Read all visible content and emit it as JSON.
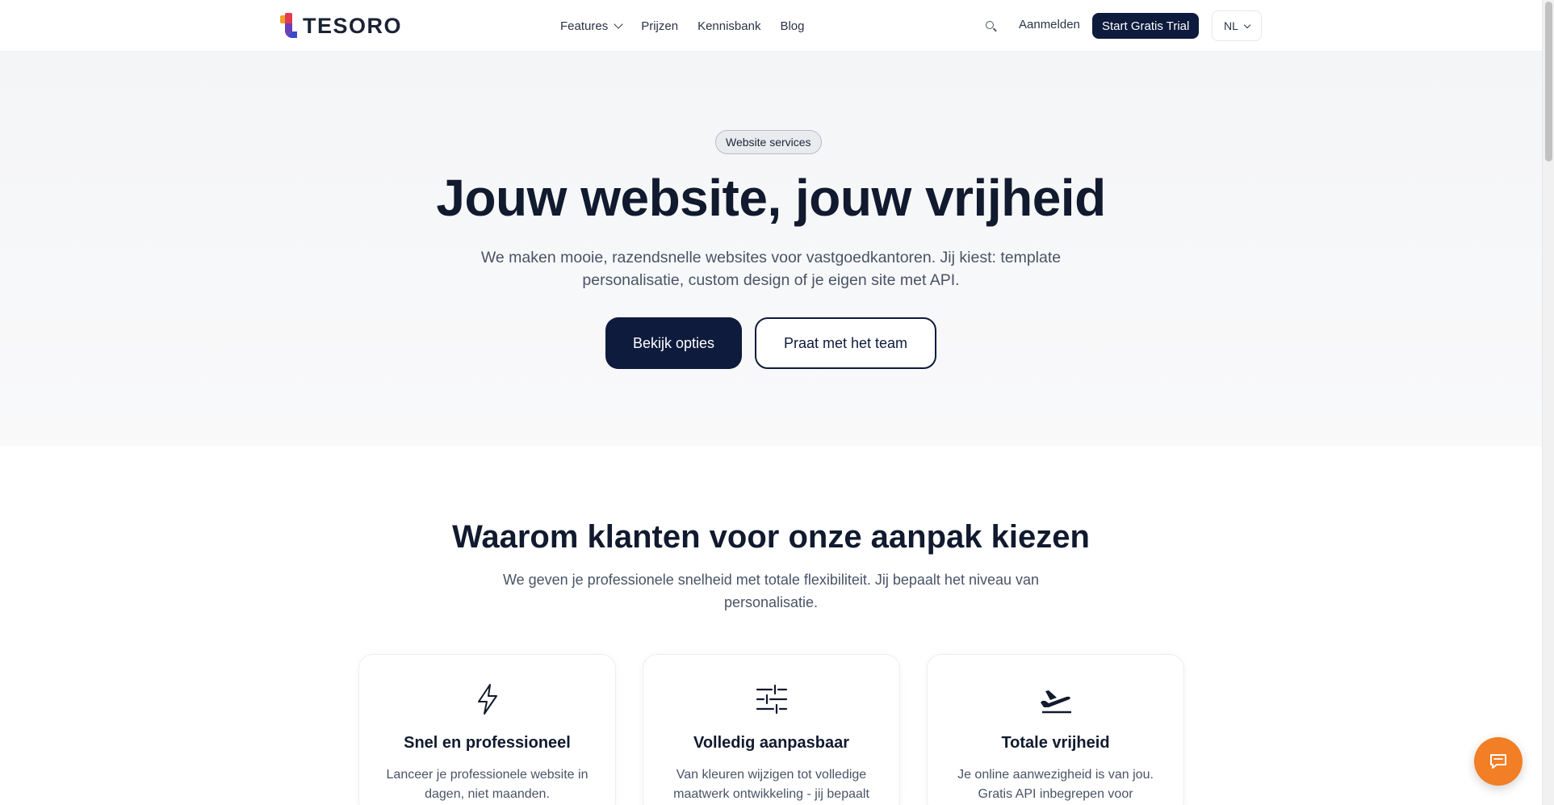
{
  "header": {
    "logo_text": "TESORO",
    "nav": [
      {
        "label": "Features"
      },
      {
        "label": "Prijzen"
      },
      {
        "label": "Kennisbank"
      },
      {
        "label": "Blog"
      }
    ],
    "login_label": "Aanmelden",
    "trial_label": "Start Gratis Trial",
    "language": "NL"
  },
  "hero": {
    "badge": "Website services",
    "title": "Jouw website, jouw vrijheid",
    "subtitle": "We maken mooie, razendsnelle websites voor vastgoedkantoren. Jij kiest: template personalisatie, custom design of je eigen site met API.",
    "primary_cta": "Bekijk opties",
    "secondary_cta": "Praat met het team"
  },
  "why": {
    "title": "Waarom klanten voor onze aanpak kiezen",
    "subtitle": "We geven je professionele snelheid met totale flexibiliteit. Jij bepaalt het niveau van personalisatie.",
    "cards": [
      {
        "icon": "lightning-icon",
        "title": "Snel en professioneel",
        "text": "Lanceer je professionele website in dagen, niet maanden."
      },
      {
        "icon": "sliders-icon",
        "title": "Volledig aanpasbaar",
        "text": "Van kleuren wijzigen tot volledige maatwerk ontwikkeling - jij bepaalt"
      },
      {
        "icon": "plane-takeoff-icon",
        "title": "Totale vrijheid",
        "text": "Je online aanwezigheid is van jou. Gratis API inbegrepen voor"
      }
    ]
  },
  "colors": {
    "primary": "#0e1b3d",
    "accent_chat": "#f27e25",
    "text": "#111a2e",
    "muted": "#4a5366"
  }
}
